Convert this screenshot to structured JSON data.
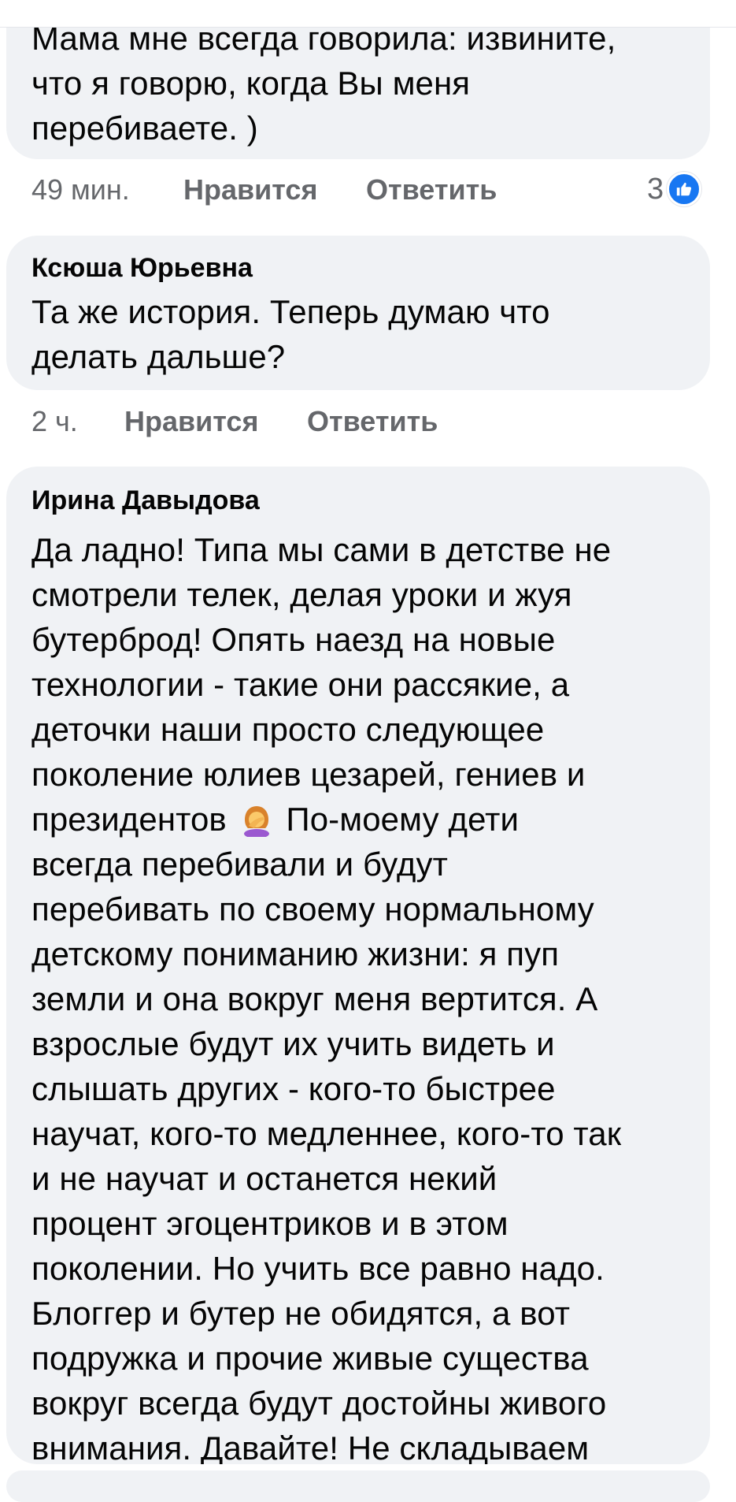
{
  "comments": [
    {
      "text": "Мама мне всегда говорила: извините,\nчто я говорю, когда Вы меня\nперебиваете. )",
      "time": "49 мин.",
      "like_label": "Нравится",
      "reply_label": "Ответить",
      "reaction_count": "3",
      "reaction_icon": "like-icon"
    },
    {
      "author": "Ксюша Юрьевна",
      "text": "Та же история. Теперь думаю что\nделать дальше?",
      "time": "2 ч.",
      "like_label": "Нравится",
      "reply_label": "Ответить"
    },
    {
      "author": "Ирина Давыдова",
      "text_part1": "Да ладно! Типа мы сами в детстве не\nсмотрели телек, делая уроки и жуя\nбутерброд! Опять наезд на новые\nтехнологии - такие они рассякие, а\nдеточки наши просто следующее\nпоколение юлиев цезарей, гениев и\nпрезидентов",
      "emoji": "woman-facepalming-emoji",
      "text_part2": "По-моему дети\nвсегда перебивали и будут\nперебивать по своему нормальному\nдетскому пониманию жизни: я пуп\nземли и она вокруг меня вертится. А\nвзрослые будут их учить видеть и\nслышать других - кого-то быстрее\nнаучат, кого-то медленнее, кого-то так\nи не научат и останется некий\nпроцент эгоцентриков и в этом\nпоколении. Но учить все равно надо.\nБлоггер и бутер не обидятся, а вот\nподружка и прочие живые существа\nвокруг всегда будут достойны живого\nвнимания. Давайте! Не складываем"
    }
  ],
  "colors": {
    "bubble": "#f0f2f5",
    "meta_text": "#65676b",
    "like_blue": "#1877f2"
  }
}
